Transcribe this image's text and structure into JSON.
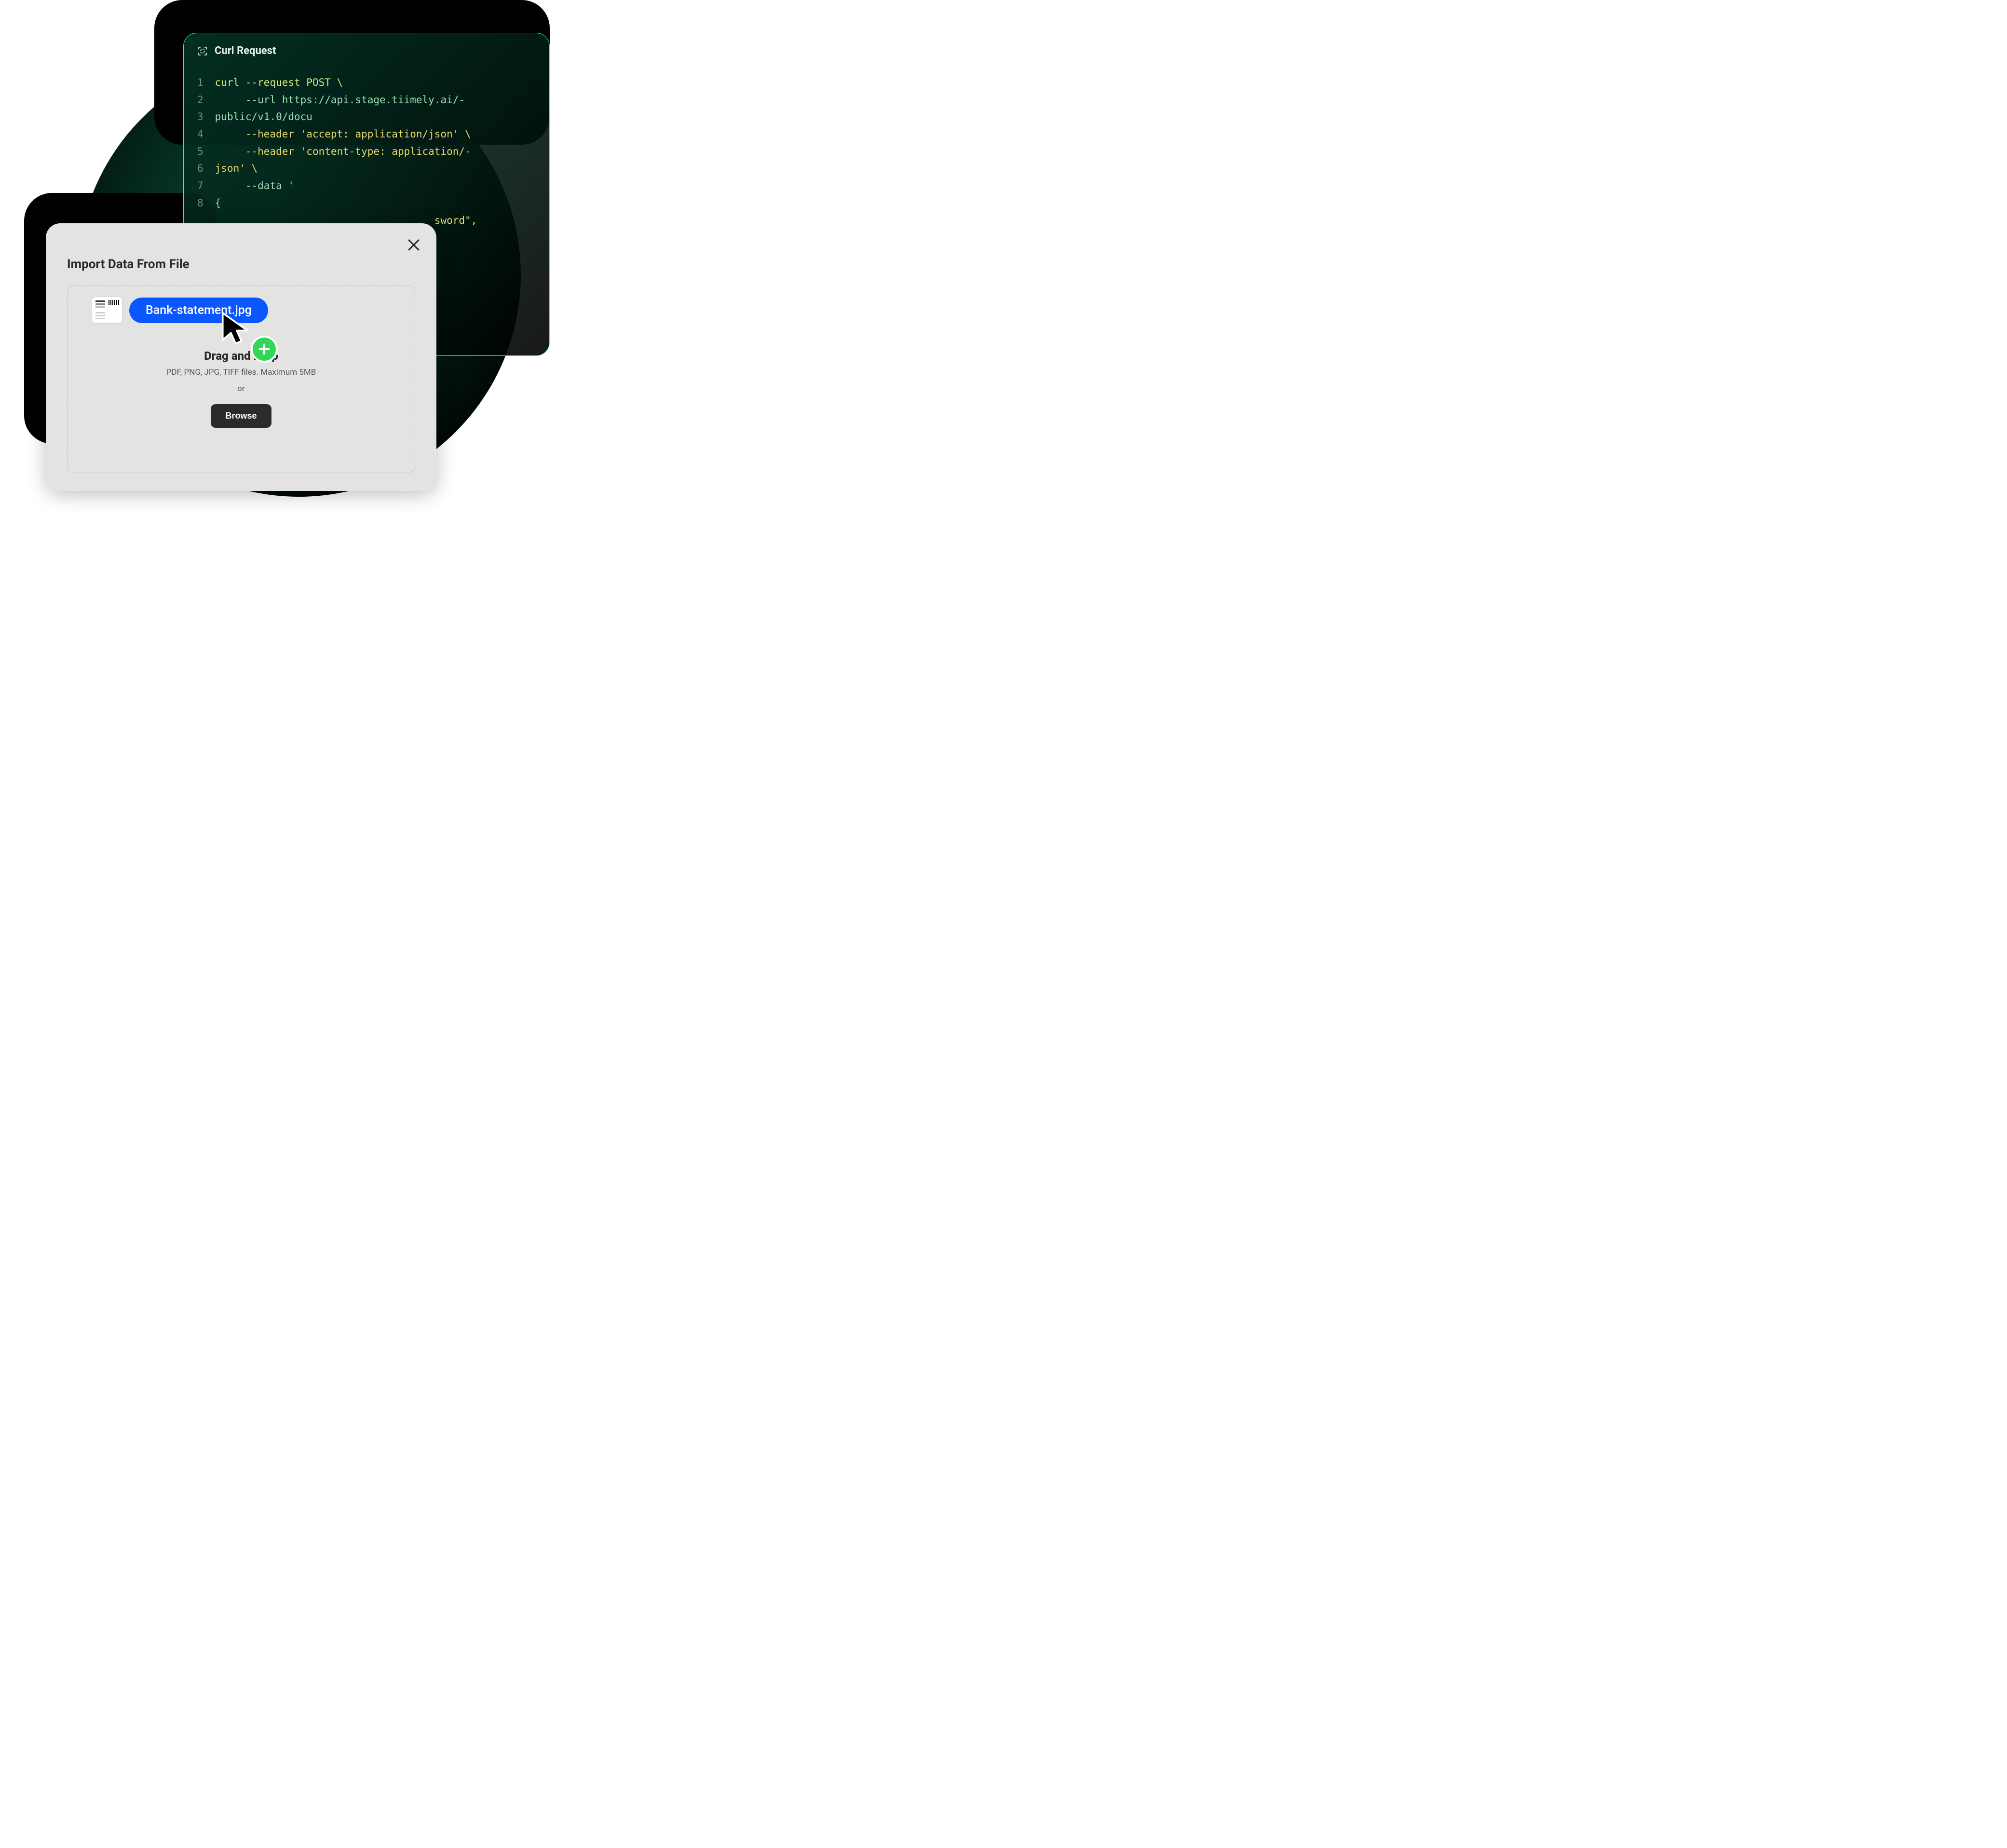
{
  "codePanel": {
    "title": "Curl Request",
    "lines": [
      "curl --request POST \\",
      "     --url https://api.stage.tiimely.ai/-",
      "public/v1.0/docu",
      "     --header 'accept: application/json' \\",
      "     --header 'content-type: application/-",
      "json' \\",
      "     --data '",
      "{",
      "                                    sword\","
    ]
  },
  "importModal": {
    "title": "Import Data From File",
    "drop_heading": "Drag and Drop",
    "drop_sub": "PDF, PNG, JPG, TIFF files. Maximum 5MB",
    "or_label": "or",
    "browse_label": "Browse"
  },
  "fileChip": {
    "filename": "Bank-statement.jpg"
  }
}
